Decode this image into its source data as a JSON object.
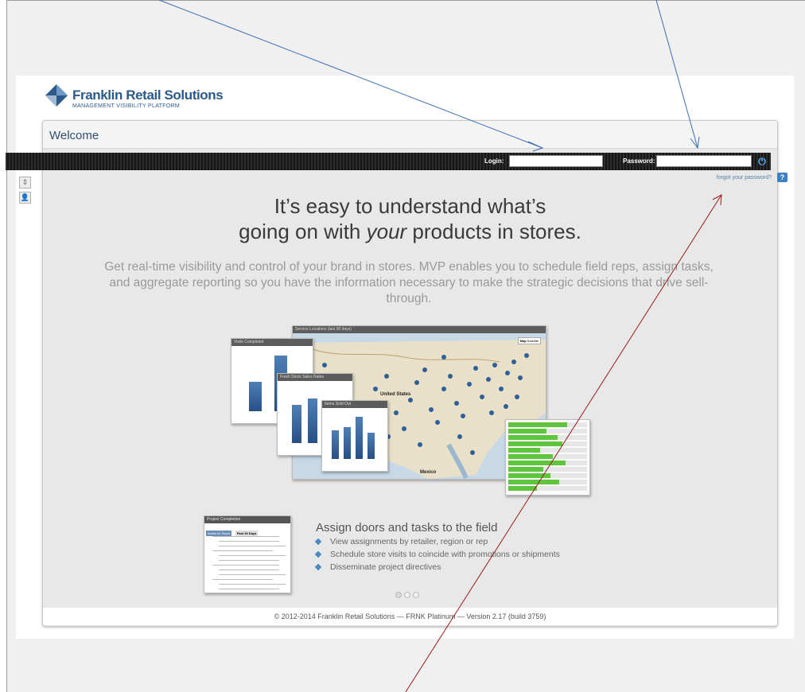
{
  "brand": {
    "name": "Franklin Retail Solutions",
    "tagline": "MANAGEMENT VISIBILITY PLATFORM",
    "color": "#2b5a8a"
  },
  "header": {
    "title": "Welcome"
  },
  "login": {
    "login_label": "Login:",
    "password_label": "Password:",
    "login_value": "",
    "password_value": "",
    "submit_icon": "power-icon",
    "forgot_link": "forgot your password?",
    "help_label": "?"
  },
  "hero": {
    "headline_line1": "It’s easy to understand what’s",
    "headline_line2_pre": "going on with ",
    "headline_line2_em": "your",
    "headline_line2_post": " products in stores.",
    "subtitle": "Get real-time visibility and control of your brand in stores. MVP enables you to schedule field reps, assign tasks, and aggregate reporting so you have the information necessary to make the strategic decisions that drive sell-through."
  },
  "collage": {
    "map_title": "Service Locations (last 90 days)",
    "map_tab_map": "Map",
    "map_tab_satellite": "Satellite",
    "map_label_us": "United States",
    "map_label_mexico": "Mexico",
    "chart1_title": "Visits Completed",
    "chart2_title": "Fresh Stock Sales Rates",
    "chart3_title": "Items Sold Out",
    "chart1_values": [
      0.45,
      0.85
    ],
    "chart2_values": [
      0.6,
      0.7,
      0.55
    ],
    "chart3_values": [
      0.55,
      0.6,
      0.8,
      0.5
    ]
  },
  "feature": {
    "panel_title": "Project Completion",
    "panel_tab1": "Active for Rep/s",
    "panel_tab2": "Past 30 Days",
    "title": "Assign doors and tasks to the field",
    "bullets": [
      "View assignments by retailer, region or rep",
      "Schedule store visits to coincide with promotions or shipments",
      "Disseminate project directives"
    ]
  },
  "footer": {
    "text": "© 2012-2014 Franklin Retail Solutions — FRNK Platinum — Version 2.17 (build 3759)"
  },
  "colors": {
    "accent": "#3d7fc3",
    "loginbar": "#1b1b1b",
    "annotation_blue": "#3a6db8",
    "annotation_red": "#9b1c1c"
  }
}
